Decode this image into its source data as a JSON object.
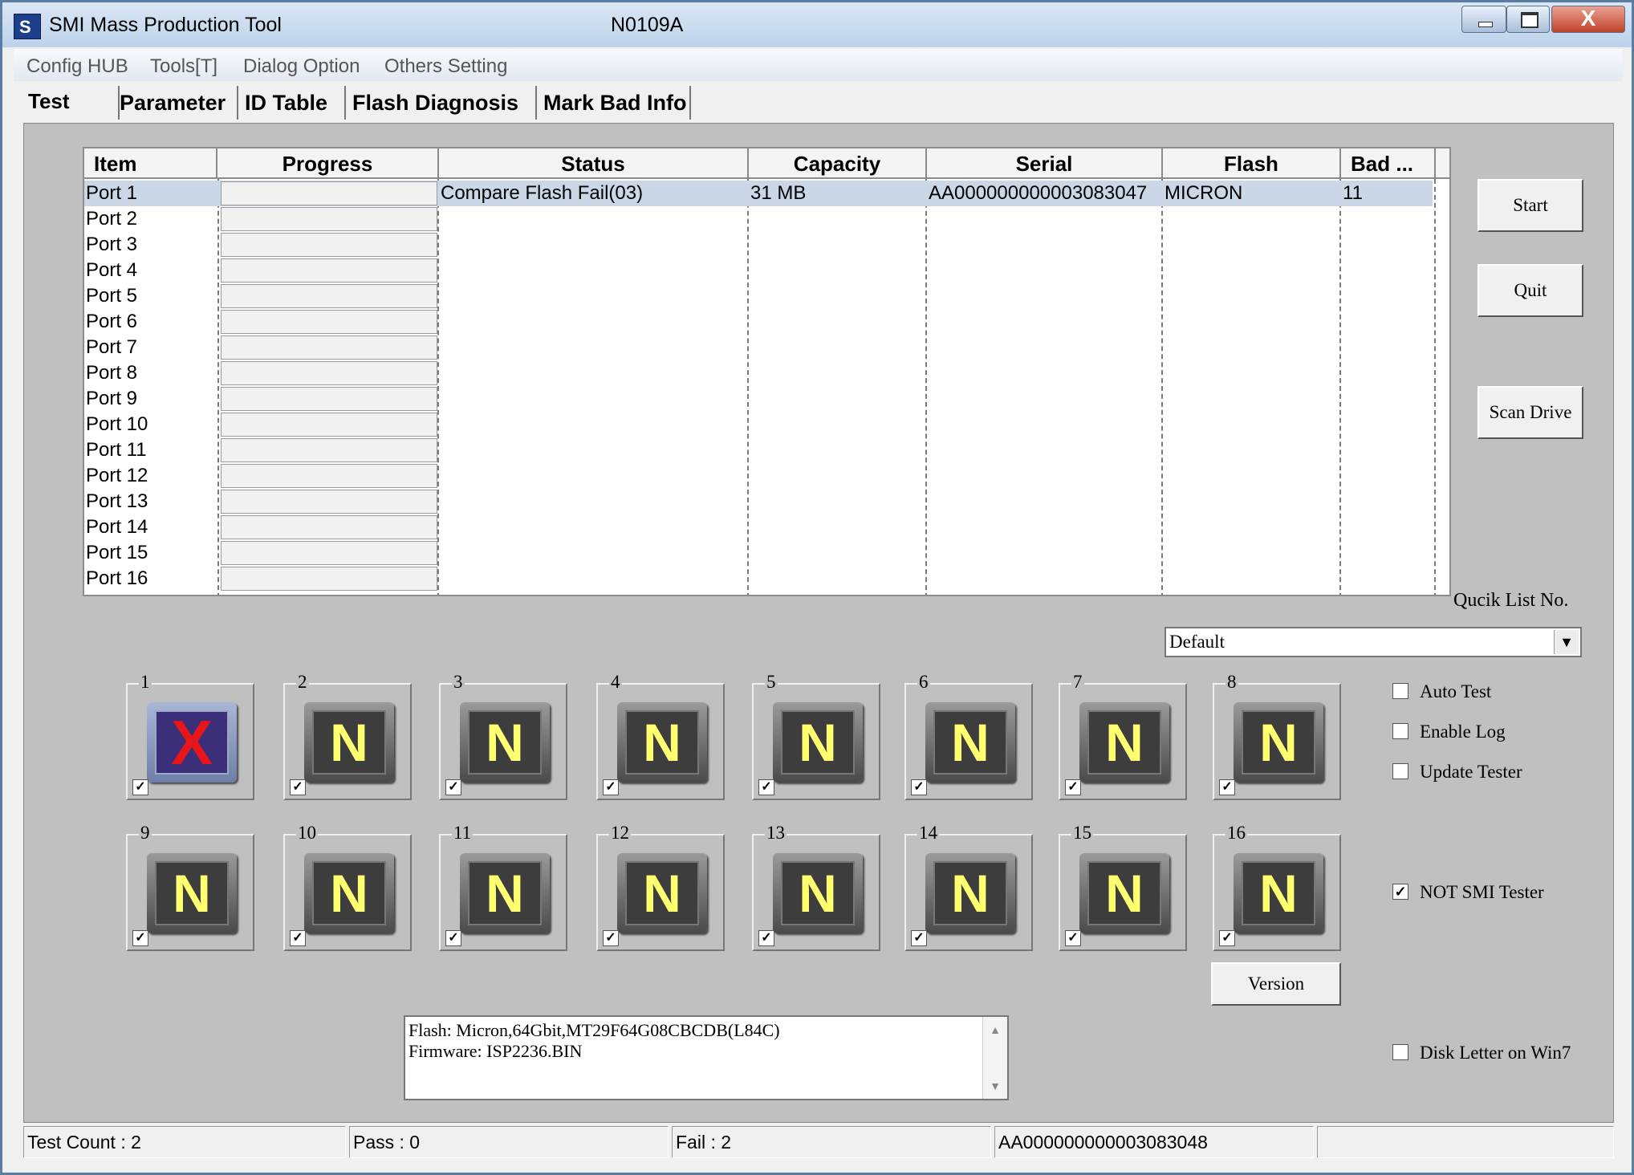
{
  "window": {
    "title": "SMI Mass Production Tool",
    "version": "N0109A",
    "close_glyph": "X",
    "icon_glyph": "S"
  },
  "menu": [
    "Config HUB",
    "Tools[T]",
    "Dialog Option",
    "Others Setting"
  ],
  "tabs": [
    "Test",
    "Parameter",
    "ID Table",
    "Flash Diagnosis",
    "Mark Bad Info"
  ],
  "grid": {
    "headers": [
      "Item",
      "Progress",
      "Status",
      "Capacity",
      "Serial",
      "Flash",
      "Bad ..."
    ],
    "rows": [
      {
        "item": "Port 1",
        "status": "Compare Flash Fail(03)",
        "capacity": "31 MB",
        "serial": "AA000000000003083047",
        "flash": "MICRON",
        "bad": "11"
      },
      {
        "item": "Port 2"
      },
      {
        "item": "Port 3"
      },
      {
        "item": "Port 4"
      },
      {
        "item": "Port 5"
      },
      {
        "item": "Port 6"
      },
      {
        "item": "Port 7"
      },
      {
        "item": "Port 8"
      },
      {
        "item": "Port 9"
      },
      {
        "item": "Port 10"
      },
      {
        "item": "Port 11"
      },
      {
        "item": "Port 12"
      },
      {
        "item": "Port 13"
      },
      {
        "item": "Port 14"
      },
      {
        "item": "Port 15"
      },
      {
        "item": "Port 16"
      }
    ]
  },
  "buttons": {
    "start": "Start",
    "quit": "Quit",
    "scan_drive": "Scan Drive",
    "version": "Version"
  },
  "quick_list": {
    "label": "Qucik List No.",
    "selected": "Default",
    "arrow": "▼"
  },
  "options": {
    "auto_test": {
      "label": "Auto Test",
      "checked": false
    },
    "enable_log": {
      "label": "Enable Log",
      "checked": false
    },
    "update_tester": {
      "label": "Update Tester",
      "checked": false
    },
    "not_smi_tester": {
      "label": "NOT SMI Tester",
      "checked": true
    },
    "disk_letter": {
      "label": "Disk Letter on Win7",
      "checked": false
    }
  },
  "check_mark": "✓",
  "ports": [
    {
      "num": "1",
      "glyph": "X",
      "state": "fail",
      "checked": true
    },
    {
      "num": "2",
      "glyph": "N",
      "state": "none",
      "checked": true
    },
    {
      "num": "3",
      "glyph": "N",
      "state": "none",
      "checked": true
    },
    {
      "num": "4",
      "glyph": "N",
      "state": "none",
      "checked": true
    },
    {
      "num": "5",
      "glyph": "N",
      "state": "none",
      "checked": true
    },
    {
      "num": "6",
      "glyph": "N",
      "state": "none",
      "checked": true
    },
    {
      "num": "7",
      "glyph": "N",
      "state": "none",
      "checked": true
    },
    {
      "num": "8",
      "glyph": "N",
      "state": "none",
      "checked": true
    },
    {
      "num": "9",
      "glyph": "N",
      "state": "none",
      "checked": true
    },
    {
      "num": "10",
      "glyph": "N",
      "state": "none",
      "checked": true
    },
    {
      "num": "11",
      "glyph": "N",
      "state": "none",
      "checked": true
    },
    {
      "num": "12",
      "glyph": "N",
      "state": "none",
      "checked": true
    },
    {
      "num": "13",
      "glyph": "N",
      "state": "none",
      "checked": true
    },
    {
      "num": "14",
      "glyph": "N",
      "state": "none",
      "checked": true
    },
    {
      "num": "15",
      "glyph": "N",
      "state": "none",
      "checked": true
    },
    {
      "num": "16",
      "glyph": "N",
      "state": "none",
      "checked": true
    }
  ],
  "info": {
    "line1": "Flash: Micron,64Gbit,MT29F64G08CBCDB(L84C)",
    "line2": "Firmware: ISP2236.BIN",
    "scroll_up": "▲",
    "scroll_down": "▼"
  },
  "status": {
    "test_count": "Test Count : 2",
    "pass": "Pass : 0",
    "fail": "Fail : 2",
    "serial": "AA000000000003083048",
    "extra": ""
  }
}
